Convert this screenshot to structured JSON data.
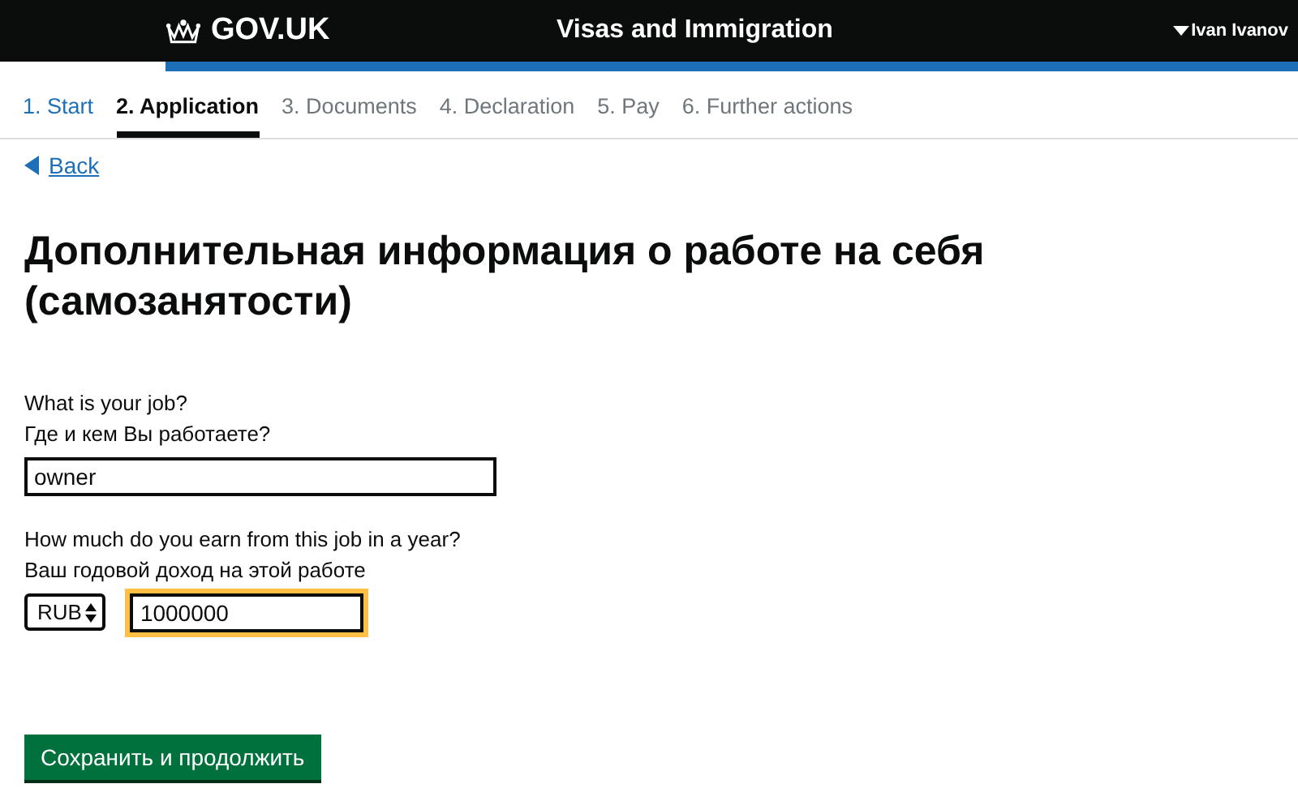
{
  "header": {
    "logo": "GOV.UK",
    "service": "Visas and Immigration",
    "user": "Ivan Ivanov"
  },
  "steps": [
    {
      "label": "1. Start",
      "completed": true,
      "selected": false
    },
    {
      "label": "2. Application",
      "completed": false,
      "selected": true
    },
    {
      "label": "3. Documents",
      "completed": false,
      "selected": false
    },
    {
      "label": "4. Declaration",
      "completed": false,
      "selected": false
    },
    {
      "label": "5. Pay",
      "completed": false,
      "selected": false
    },
    {
      "label": "6. Further actions",
      "completed": false,
      "selected": false
    }
  ],
  "back_link": "Back",
  "heading": "Дополнительная информация о работе на себя (самозанятости)",
  "job": {
    "label": "What is your job?",
    "label_ru": "Где и кем Вы работаете?",
    "value": "owner"
  },
  "income": {
    "label": "How much do you earn from this job in a year?",
    "label_ru": "Ваш годовой доход на этой работе",
    "currency": "RUB",
    "value": "1000000",
    "focused": true
  },
  "submit": "Сохранить и продолжить"
}
